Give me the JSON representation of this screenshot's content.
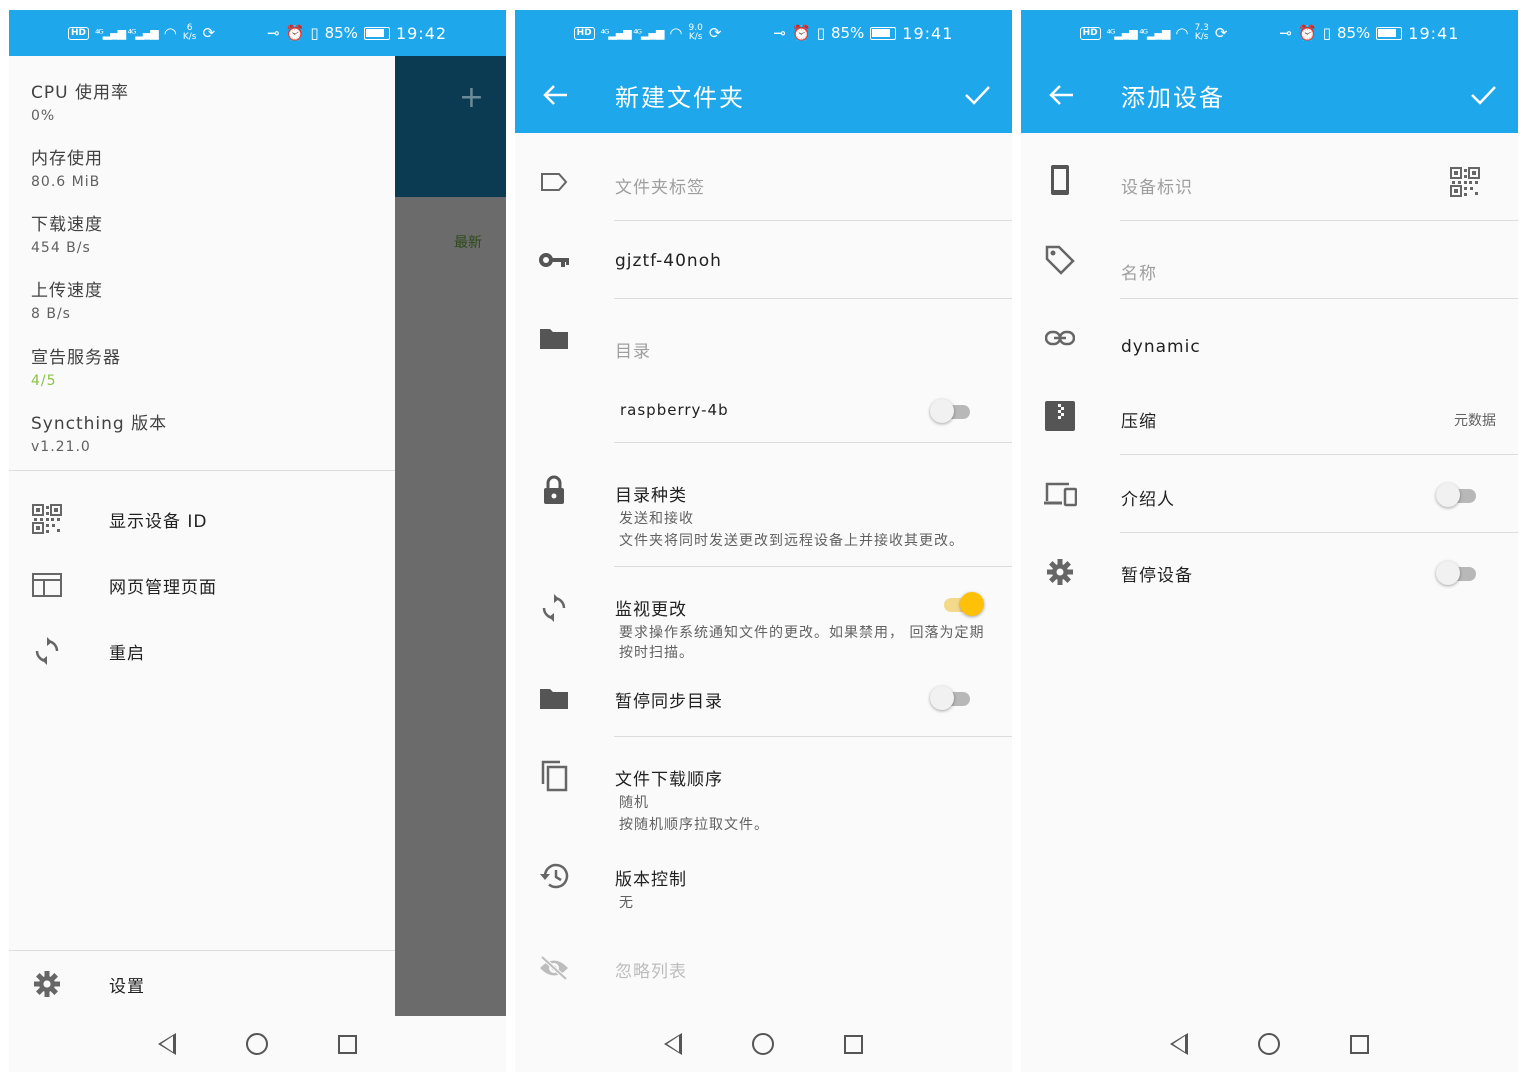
{
  "colors": {
    "primary": "#1ea7ea",
    "accent": "#ffc107",
    "green": "#8bc34a"
  },
  "status_bars": [
    {
      "net_speed": "6",
      "speed_unit": "K/s",
      "battery": "85%",
      "time": "19:42"
    },
    {
      "net_speed": "9.0",
      "speed_unit": "K/s",
      "battery": "85%",
      "time": "19:41"
    },
    {
      "net_speed": "7.3",
      "speed_unit": "K/s",
      "battery": "85%",
      "time": "19:41"
    }
  ],
  "panel1": {
    "background": {
      "plus": "+",
      "latest": "最新"
    },
    "stats": [
      {
        "label": "CPU 使用率",
        "value": "0%"
      },
      {
        "label": "内存使用",
        "value": "80.6 MiB"
      },
      {
        "label": "下载速度",
        "value": "454 B/s"
      },
      {
        "label": "上传速度",
        "value": "8 B/s"
      },
      {
        "label": "宣告服务器",
        "value": "4/5"
      },
      {
        "label": "Syncthing 版本",
        "value": "v1.21.0"
      }
    ],
    "menu": [
      {
        "label": "显示设备 ID",
        "icon": "qr-code-icon"
      },
      {
        "label": "网页管理页面",
        "icon": "web-icon"
      },
      {
        "label": "重启",
        "icon": "restart-icon"
      }
    ],
    "settings": {
      "label": "设置",
      "icon": "gear-icon"
    }
  },
  "panel2": {
    "title": "新建文件夹",
    "label_placeholder": "文件夹标签",
    "folder_id": "gjztf-40noh",
    "directory_hint": "目录",
    "device": "raspberry-4b",
    "folder_type": {
      "title": "目录种类",
      "value": "发送和接收",
      "desc": "文件夹将同时发送更改到远程设备上并接收其更改。"
    },
    "watch": {
      "title": "监视更改",
      "desc": "要求操作系统通知文件的更改。如果禁用， 回落为定期按时扫描。"
    },
    "pause": {
      "title": "暂停同步目录"
    },
    "pull_order": {
      "title": "文件下载顺序",
      "value": "随机",
      "desc": "按随机顺序拉取文件。"
    },
    "versioning": {
      "title": "版本控制",
      "value": "无"
    },
    "ignore": {
      "title": "忽略列表"
    }
  },
  "panel3": {
    "title": "添加设备",
    "device_id_placeholder": "设备标识",
    "name_placeholder": "名称",
    "address": "dynamic",
    "compression": {
      "title": "压缩",
      "value": "元数据"
    },
    "introducer": {
      "title": "介绍人"
    },
    "pause": {
      "title": "暂停设备"
    }
  }
}
